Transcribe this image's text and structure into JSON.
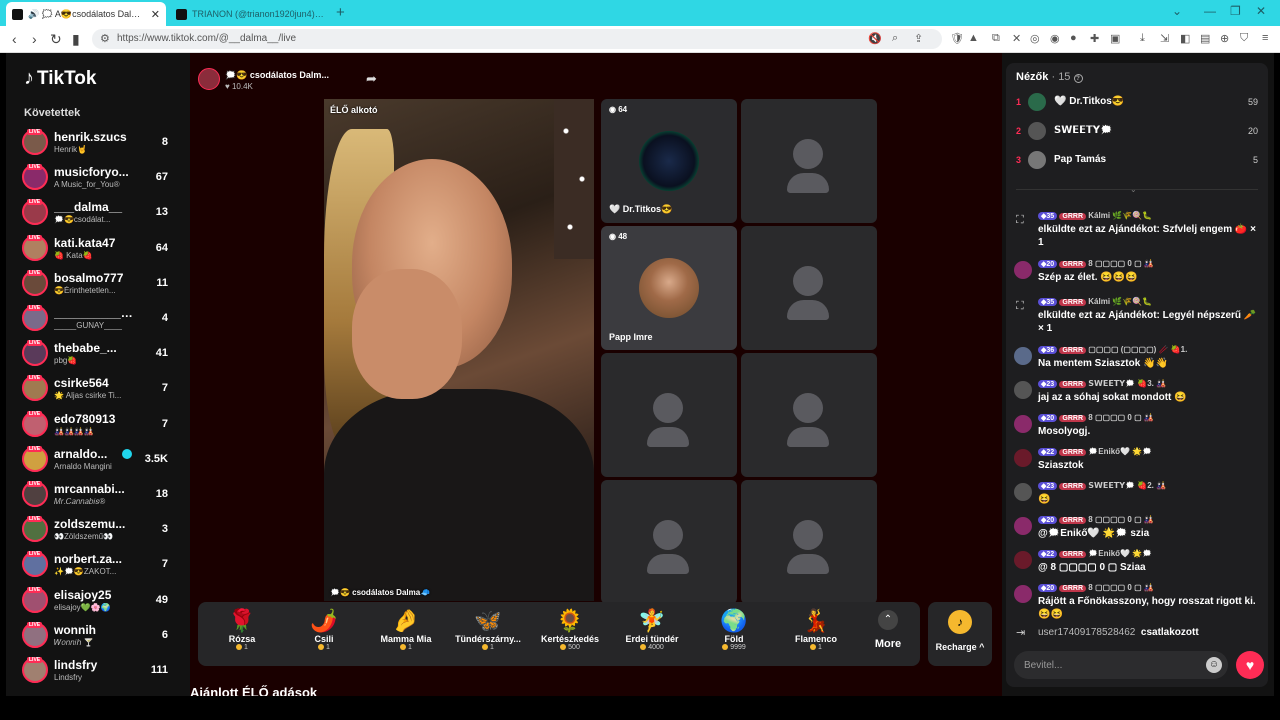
{
  "browser": {
    "tabs": [
      {
        "title": "🔊 🗯️ A😎csodálatos Dalma🧢"
      },
      {
        "title": "TRIANON (@trianon1920jun4) Ét"
      }
    ],
    "url": "https://www.tiktok.com/@__dalma__/live"
  },
  "sidebar": {
    "logo": "TikTok",
    "following_title": "Követettek",
    "live_badge": "LIVE",
    "items": [
      {
        "name": "henrik.szucs",
        "sub": "Henrik🤘",
        "count": "8"
      },
      {
        "name": "musicforyo...",
        "sub": "A Music_for_You®",
        "count": "67"
      },
      {
        "name": "___dalma__",
        "sub": "🗯️😎csodálat...",
        "count": "13"
      },
      {
        "name": "kati.kata47",
        "sub": "🍓 Kata🍓",
        "count": "64"
      },
      {
        "name": "bosalmo777",
        "sub": "😎Érinthetetlen...",
        "count": "11"
      },
      {
        "name": "__________gu...",
        "sub": "_____GUNAY____",
        "count": "4"
      },
      {
        "name": "thebabe_...",
        "sub": "pbg🍓",
        "count": "41"
      },
      {
        "name": "csirke564",
        "sub": "🌟 Aljas csirke Ti...",
        "count": "7"
      },
      {
        "name": "edo780913",
        "sub": "🎎🎎🎎🎎",
        "count": "7"
      },
      {
        "name": "arnaldo...",
        "sub": "Arnaldo Mangini",
        "count": "3.5K"
      },
      {
        "name": "mrcannabi...",
        "sub": "𝑀𝑟.𝐶𝑎𝑛𝑛𝑎𝑏𝑖𝑠®",
        "count": "18"
      },
      {
        "name": "zoldszemu...",
        "sub": "👀Zöldszemű👀",
        "count": "3"
      },
      {
        "name": "norbert.za...",
        "sub": "✨🗯️😎ZAKOT...",
        "count": "7"
      },
      {
        "name": "elisajoy25",
        "sub": "elisajoy💚🌸🌍",
        "count": "49"
      },
      {
        "name": "wonnih",
        "sub": "𝑊𝑜𝑛𝑛𝑖𝘩 🍸",
        "count": "6"
      },
      {
        "name": "lindsfry",
        "sub": "Lindsfry",
        "count": "111"
      }
    ]
  },
  "stream": {
    "host_name": "🗯️😎 csodálatos Dalm...",
    "host_likes": "♥ 10.4K",
    "video_label": "ÉLŐ alkotó",
    "video_caption": "🗯️😎 csodálatos Dalma🧢",
    "guests": [
      {
        "count": "64",
        "name": "🤍 Dr.Titkos😎"
      },
      {
        "count": "48",
        "name": "Papp Imre"
      }
    ],
    "gifts": [
      {
        "name": "Rózsa",
        "price": "1",
        "icon": "🌹"
      },
      {
        "name": "Csili",
        "price": "1",
        "icon": "🌶️"
      },
      {
        "name": "Mamma Mia",
        "price": "1",
        "icon": "🤌"
      },
      {
        "name": "Tündérszárny...",
        "price": "1",
        "icon": "🦋"
      },
      {
        "name": "Kertészkedés",
        "price": "500",
        "icon": "🌻"
      },
      {
        "name": "Erdei tündér",
        "price": "4000",
        "icon": "🧚"
      },
      {
        "name": "Föld",
        "price": "9999",
        "icon": "🌍"
      },
      {
        "name": "Flamenco",
        "price": "1",
        "icon": "💃"
      }
    ],
    "more_label": "More",
    "recharge_label": "Recharge ^",
    "recommended_title": "Ajánlott ÉLŐ adások"
  },
  "chat": {
    "viewers_label": "Nézők",
    "viewers_count": "· 15",
    "top_viewers": [
      {
        "rank": "1",
        "name": "🤍 Dr.Titkos😎",
        "score": "59"
      },
      {
        "rank": "2",
        "name": "𝗦𝗪𝗘𝗘𝗧𝗬🗯️",
        "score": "20"
      },
      {
        "rank": "3",
        "name": "Pap Tamás",
        "score": "5"
      }
    ],
    "messages": [
      {
        "level": "35",
        "user": "Kálmi 🌿🌾🍭🐛",
        "text": "elküldte ezt az Ajándékot: Szfvlelj engem 🍅 × 1"
      },
      {
        "level": "20",
        "user": "8 ▢▢▢▢ 0 ▢ 🎎",
        "text": "Szép az élet. 😆😆😆"
      },
      {
        "level": "35",
        "user": "Kálmi 🌿🌾🍭🐛",
        "text": "elküldte ezt az Ajándékot: Legyél népszerű 🥕 × 1"
      },
      {
        "level": "36",
        "user": "▢▢▢▢ (▢▢▢▢) 🥢 🍓1.",
        "text": "Na mentem Sziasztok 👋👋"
      },
      {
        "level": "23",
        "user": "𝗦𝗪𝗘𝗘𝗧𝗬🗯️ 🍓3. 🎎",
        "text": "jaj az a sóhaj sokat mondott 😆"
      },
      {
        "level": "20",
        "user": "8 ▢▢▢▢ 0 ▢ 🎎",
        "text": "Mosolyogj."
      },
      {
        "level": "22",
        "user": "🗯️Enikő🤍 🌟🗯️",
        "text": "Sziasztok"
      },
      {
        "level": "23",
        "user": "𝗦𝗪𝗘𝗘𝗧𝗬🗯️ 🍓2. 🎎",
        "text": "😆"
      },
      {
        "level": "20",
        "user": "8 ▢▢▢▢ 0 ▢ 🎎",
        "text": "@🗯️Enikő🤍 🌟🗯️ szia"
      },
      {
        "level": "22",
        "user": "🗯️Enikő🤍 🌟🗯️",
        "text": "@ 8 ▢▢▢▢ 0 ▢ Sziaa"
      },
      {
        "level": "20",
        "user": "8 ▢▢▢▢ 0 ▢ 🎎",
        "text": "Rájött a Főnökasszony, hogy rosszat rigott ki. 😆😆"
      }
    ],
    "grrr_label": "GRRR",
    "join_notice": {
      "user": "user17409178528462",
      "text": "csatlakozott"
    },
    "input_placeholder": "Bevitel..."
  }
}
